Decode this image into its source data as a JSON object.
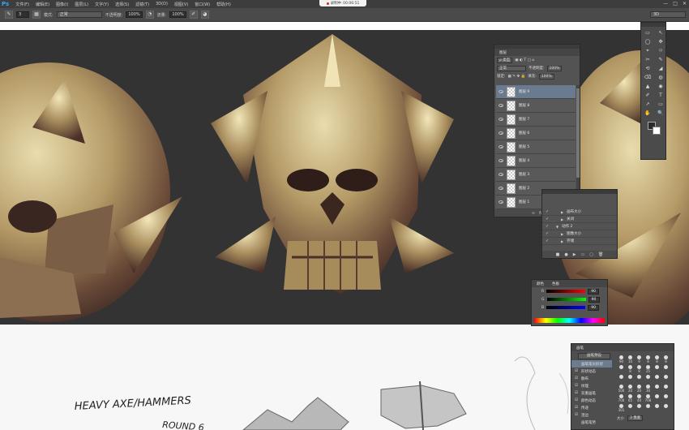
{
  "app": {
    "logo": "Ps",
    "menus": [
      "文件(F)",
      "编辑(E)",
      "图像(I)",
      "图层(L)",
      "文字(Y)",
      "选择(S)",
      "滤镜(T)",
      "3D(D)",
      "视图(V)",
      "窗口(W)",
      "帮助(H)"
    ],
    "window_controls": [
      "—",
      "□",
      "✕"
    ]
  },
  "recorder": {
    "label": "录制中",
    "time": "00:06:51"
  },
  "options_bar": {
    "brush_size": "3",
    "mode_label": "模式:",
    "mode_value": "正常",
    "opacity_label": "不透明度:",
    "opacity_value": "100%",
    "flow_label": "流量:",
    "flow_value": "100%",
    "workspace": "3D"
  },
  "layers_panel": {
    "tabs": [
      "图层"
    ],
    "filter_label": "ρ 类型",
    "blend_mode": "正常",
    "opacity_label": "不透明度:",
    "opacity_value": "100%",
    "lock_label": "锁定:",
    "fill_label": "填充:",
    "fill_value": "100%",
    "layers": [
      {
        "name": "图层 9",
        "selected": true
      },
      {
        "name": "图层 8",
        "selected": false
      },
      {
        "name": "图层 7",
        "selected": false
      },
      {
        "name": "图层 6",
        "selected": false
      },
      {
        "name": "图层 5",
        "selected": false
      },
      {
        "name": "图层 4",
        "selected": false
      },
      {
        "name": "图层 3",
        "selected": false
      },
      {
        "name": "图层 2",
        "selected": false
      },
      {
        "name": "图层 1",
        "selected": false
      }
    ],
    "footer_icons": [
      "∞",
      "fx",
      "◐",
      "▭",
      "▢",
      "🗑"
    ]
  },
  "toolbox": {
    "tools": [
      "▭",
      "↖",
      "◯",
      "✥",
      "⌖",
      "⌑",
      "✂",
      "✎",
      "⟲",
      "◢",
      "⌫",
      "◍",
      "▲",
      "◉",
      "✐",
      "T",
      "↗",
      "▭",
      "✋",
      "🔍"
    ]
  },
  "actions_panel": {
    "rows": [
      {
        "check": "✓",
        "indent": 1,
        "label": "画布大小"
      },
      {
        "check": "✓",
        "indent": 1,
        "label": "关闭"
      },
      {
        "check": "✓",
        "indent": 0,
        "label": "动作 2"
      },
      {
        "check": "✓",
        "indent": 1,
        "label": "图像大小"
      },
      {
        "check": "✓",
        "indent": 1,
        "label": "存储"
      }
    ],
    "footer_icons": [
      "■",
      "●",
      "▶",
      "▭",
      "▢",
      "🗑"
    ]
  },
  "color_panel": {
    "tabs": [
      "颜色",
      "色板"
    ],
    "channels": [
      {
        "label": "R",
        "value": "90"
      },
      {
        "label": "G",
        "value": "90"
      },
      {
        "label": "B",
        "value": "90"
      }
    ]
  },
  "brush_panel": {
    "tabs": [
      "画笔"
    ],
    "preset_button": "画笔预设",
    "options": [
      {
        "label": "画笔笔尖形状",
        "selected": true,
        "checked": false
      },
      {
        "label": "形状动态",
        "selected": false,
        "checked": true
      },
      {
        "label": "散布",
        "selected": false,
        "checked": true
      },
      {
        "label": "纹理",
        "selected": false,
        "checked": true
      },
      {
        "label": "双重画笔",
        "selected": false,
        "checked": true
      },
      {
        "label": "颜色动态",
        "selected": false,
        "checked": true
      },
      {
        "label": "传递",
        "selected": false,
        "checked": true
      },
      {
        "label": "湿边",
        "selected": false,
        "checked": true
      },
      {
        "label": "画笔笔势",
        "selected": false,
        "checked": false
      }
    ],
    "tips": [
      "90",
      "10",
      "9",
      "8",
      "8",
      "8",
      "",
      "8",
      "8",
      "25",
      "",
      "",
      "",
      "",
      "",
      "",
      "",
      "",
      "500",
      "20",
      "20",
      "30",
      "",
      "",
      "700",
      "65",
      "40",
      "708",
      "",
      "",
      "301",
      "",
      "",
      "",
      "",
      ""
    ],
    "size_label": "大小",
    "size_value": "3 像素"
  },
  "sketch": {
    "title_line1": "HEAVY AXE/HAMMERS",
    "title_line2": "ROUND 6"
  },
  "colors": {
    "canvas_bg": "#333333",
    "paper_bg": "#f7f7f7",
    "panel_bg": "#535353",
    "selection": "#6a7a8f"
  }
}
